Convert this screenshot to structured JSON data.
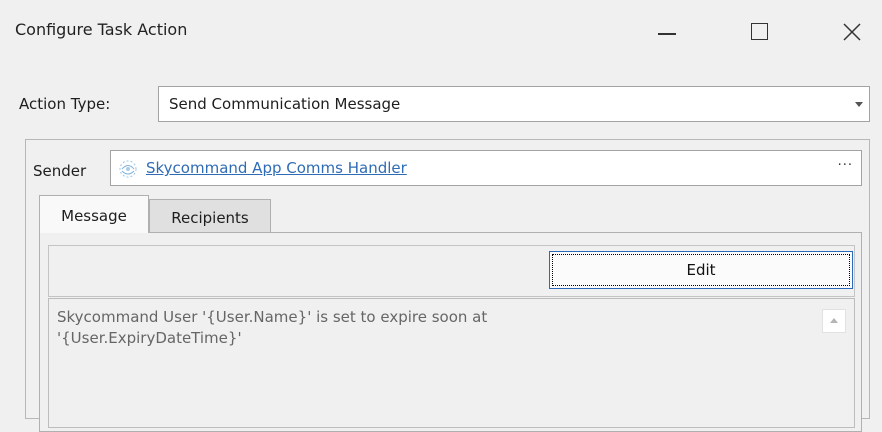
{
  "window": {
    "title": "Configure Task Action",
    "controls": {
      "minimize": "minimize-icon",
      "maximize": "maximize-icon",
      "close": "close-icon"
    }
  },
  "action_type": {
    "label": "Action Type:",
    "value": "Send Communication Message"
  },
  "sender": {
    "label": "Sender",
    "link_text": "Skycommand App Comms Handler",
    "browse_label": "···",
    "icon": "comms-handler-icon"
  },
  "tabs": [
    {
      "label": "Message",
      "active": true
    },
    {
      "label": "Recipients",
      "active": false
    }
  ],
  "message_panel": {
    "edit_label": "Edit",
    "body": "Skycommand User '{User.Name}' is set to expire soon at\n'{User.ExpiryDateTime}'"
  },
  "colors": {
    "background": "#f0f0f0",
    "link": "#2f6cb5",
    "focus_border": "#2a6ab8"
  }
}
